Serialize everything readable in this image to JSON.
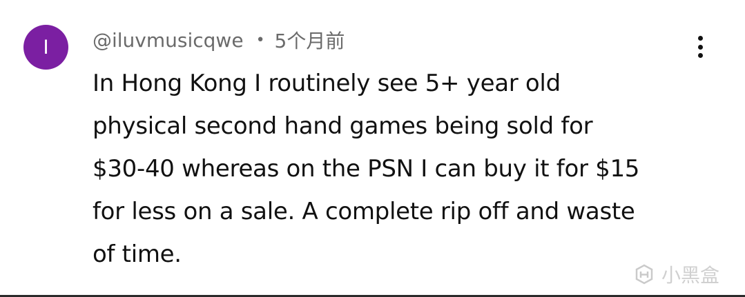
{
  "comment": {
    "avatar_letter": "I",
    "avatar_color": "#7b1fa2",
    "username": "@iluvmusicqwe",
    "separator": "•",
    "timestamp": "5个月前",
    "menu_icon": "more-vertical-icon",
    "text_lines": [
      "In Hong Kong I routinely see 5+ year old",
      "physical second hand games being sold for",
      "$30-40 whereas on the PSN I can buy it for $15",
      "for less on a sale. A complete rip off and waste",
      "of time."
    ]
  },
  "watermark": {
    "text": "小黑盒",
    "icon": "xiaoheihe-logo-icon"
  }
}
